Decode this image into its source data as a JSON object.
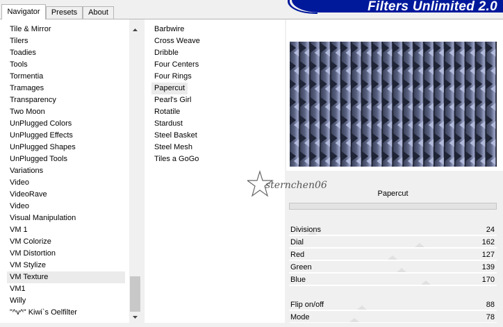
{
  "tabs": [
    "Navigator",
    "Presets",
    "About"
  ],
  "banner": "Filters Unlimited 2.0",
  "categories": [
    "Tile & Mirror",
    "Tilers",
    "Toadies",
    "Tools",
    "Tormentia",
    "Tramages",
    "Transparency",
    "Two Moon",
    "UnPlugged Colors",
    "UnPlugged Effects",
    "UnPlugged Shapes",
    "UnPlugged Tools",
    "Variations",
    "Video",
    "VideoRave",
    "Video",
    "Visual Manipulation",
    "VM 1",
    "VM Colorize",
    "VM Distortion",
    "VM Stylize",
    "VM Texture",
    "VM1",
    "Willy",
    "\"^v^\" Kiwi`s Oelfilter"
  ],
  "selected_category": "VM Texture",
  "filters": [
    "Barbwire",
    "Cross Weave",
    "Dribble",
    "Four Centers",
    "Four Rings",
    "Papercut",
    "Pearl's Girl",
    "Rotatile",
    "Stardust",
    "Steel Basket",
    "Steel Mesh",
    "Tiles a GoGo"
  ],
  "selected_filter": "Papercut",
  "filter_title": "Papercut",
  "watermark": "sternchen06",
  "params": [
    {
      "label": "Divisions",
      "value": "24",
      "level": 24
    },
    {
      "label": "Dial",
      "value": "162",
      "level": 162
    },
    {
      "label": "Red",
      "value": "127",
      "level": 127
    },
    {
      "label": "Green",
      "value": "139",
      "level": 139
    },
    {
      "label": "Blue",
      "value": "170",
      "level": 170
    },
    {
      "label": "Flip on/off",
      "value": "88",
      "level": 88
    },
    {
      "label": "Mode",
      "value": "78",
      "level": 78
    }
  ],
  "colors": {
    "banner": "#00199b",
    "preview_dark": "#2a3045",
    "preview_light": "#9aa3c8"
  },
  "icons": {
    "scroll_up": "up-arrow-icon",
    "scroll_down": "down-arrow-icon"
  }
}
